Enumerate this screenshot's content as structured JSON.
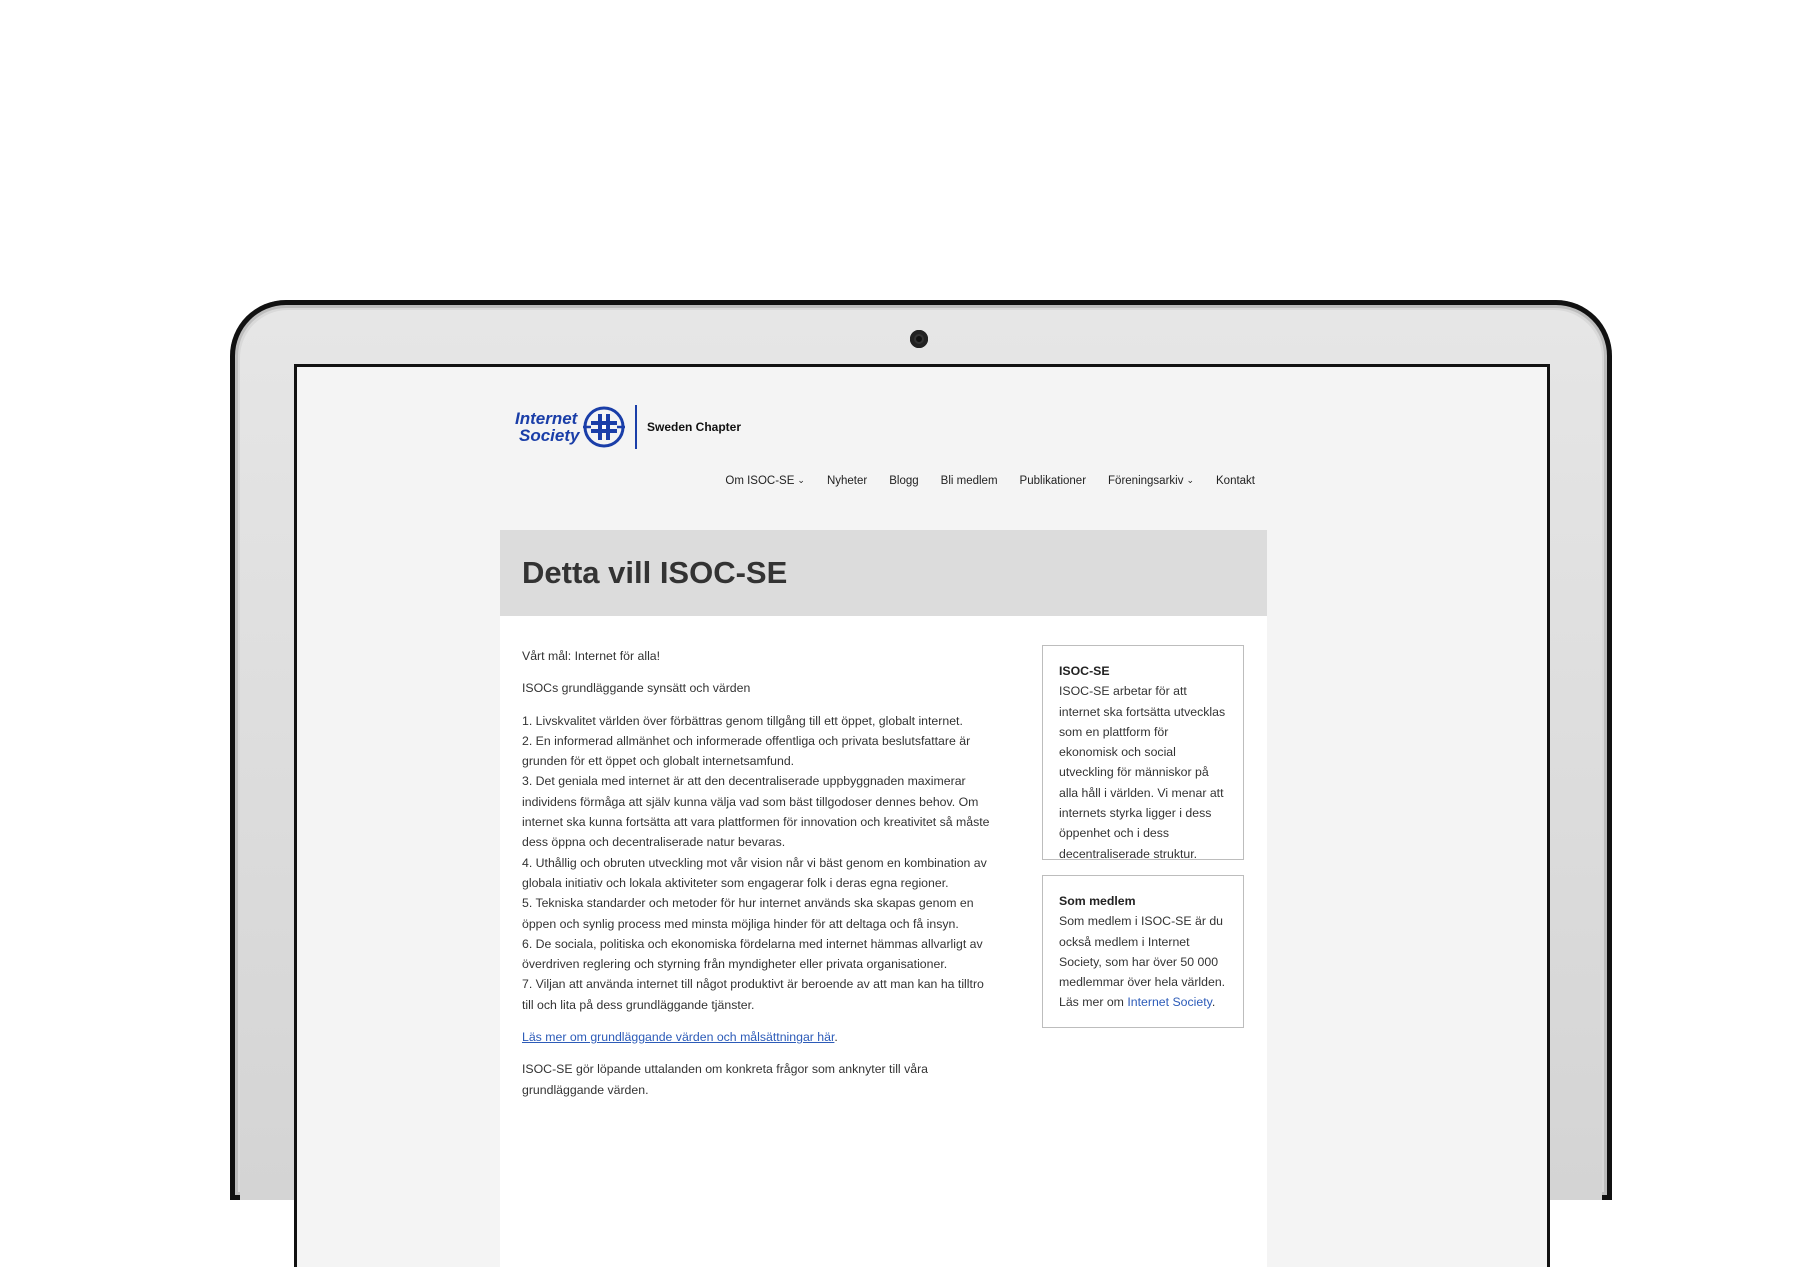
{
  "header": {
    "logo_line1": "Internet",
    "logo_line2": "Society",
    "chapter": "Sweden Chapter"
  },
  "nav": {
    "items": [
      {
        "label": "Om ISOC-SE",
        "has_dropdown": true
      },
      {
        "label": "Nyheter"
      },
      {
        "label": "Blogg"
      },
      {
        "label": "Bli medlem"
      },
      {
        "label": "Publikationer"
      },
      {
        "label": "Föreningsarkiv",
        "has_dropdown": true
      },
      {
        "label": "Kontakt"
      }
    ]
  },
  "page": {
    "title": "Detta vill ISOC-SE",
    "intro1": "Vårt mål: Internet för alla!",
    "intro2": "ISOCs grundläggande synsätt och värden",
    "list": [
      "1. Livskvalitet världen över förbättras genom tillgång till ett öppet, globalt internet.",
      "2. En informerad allmänhet och informerade offentliga och privata beslutsfattare är grunden för ett öppet och globalt internetsamfund.",
      "3. Det geniala med internet är att den decentraliserade uppbyggnaden maximerar individens förmåga att själv kunna välja vad som bäst tillgodoser dennes behov. Om internet ska kunna fortsätta att vara plattformen för innovation och kreativitet så måste dess öppna och decentraliserade natur bevaras.",
      "4. Uthållig och obruten utveckling mot vår vision når vi bäst genom en kombination av globala initiativ och lokala aktiviteter som engagerar folk i deras egna regioner.",
      "5. Tekniska standarder och metoder för hur internet används ska skapas genom en öppen och synlig process med minsta möjliga hinder för att deltaga och få insyn.",
      "6. De sociala, politiska och ekonomiska fördelarna med internet hämmas allvarligt av överdriven reglering och styrning från myndigheter eller privata organisationer.",
      "7. Viljan att använda internet till något produktivt är beroende av att man kan ha tilltro till och lita på dess grundläggande tjänster."
    ],
    "link_text": "Läs mer om grundläggande värden och målsättningar här",
    "link_suffix": ".",
    "outro": "ISOC-SE gör löpande uttalanden om konkreta frågor som anknyter till våra grundläggande värden."
  },
  "sidebar": {
    "widget1": {
      "title": "ISOC-SE",
      "text": "ISOC-SE arbetar för att internet ska fortsätta utvecklas som en plattform för ekonomisk och social utveckling för människor på alla håll i världen. Vi menar att internets styrka ligger i dess öppenhet och i dess decentraliserade struktur."
    },
    "widget2": {
      "title": "Som medlem",
      "text": "Som medlem i ISOC-SE är du också medlem i Internet Society, som har över 50 000 medlemmar över hela världen. Läs mer om ",
      "link": "Internet Society",
      "suffix": "."
    }
  },
  "colors": {
    "brand_blue": "#1a3ea8",
    "link": "#2c5bb8",
    "title_band": "#dcdcdc"
  }
}
